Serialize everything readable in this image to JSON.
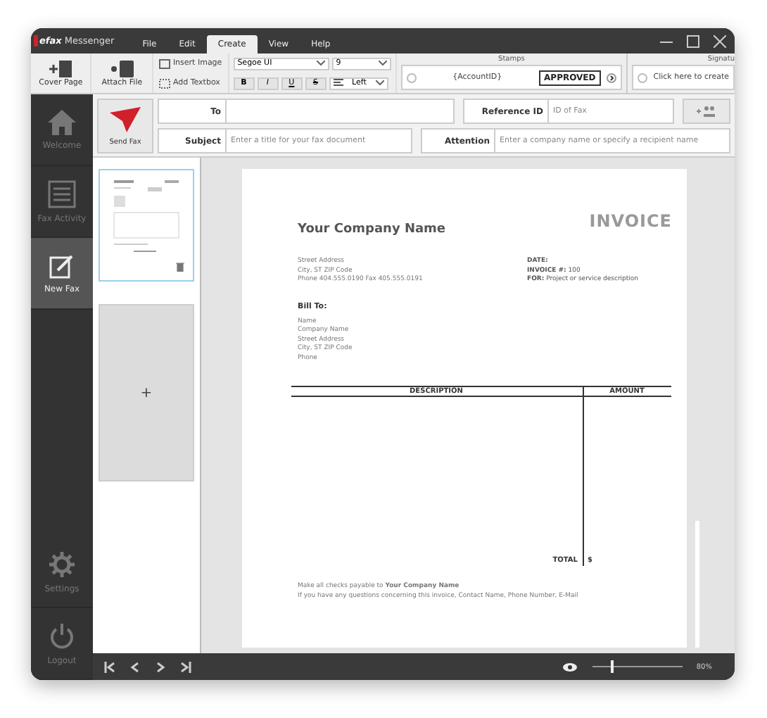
{
  "app": {
    "brand": "efax",
    "name": "Messenger"
  },
  "menu": [
    {
      "label": "File",
      "selected": false
    },
    {
      "label": "Edit",
      "selected": false
    },
    {
      "label": "Create",
      "selected": true
    },
    {
      "label": "View",
      "selected": false
    },
    {
      "label": "Help",
      "selected": false
    }
  ],
  "ribbon": {
    "big_buttons": [
      {
        "label": "Cover Page",
        "kind": "cover"
      },
      {
        "label": "Attach File",
        "kind": "attach"
      }
    ],
    "small_buttons": [
      {
        "label": "Insert Image",
        "kind": "image"
      },
      {
        "label": "Add Textbox",
        "kind": "textbox"
      }
    ],
    "font": "Segoe UI",
    "size": "9",
    "format_buttons": [
      "B",
      "I",
      "U",
      "S"
    ],
    "align": "Left",
    "stamps": {
      "title": "Stamps",
      "items": [
        "{AccountID}",
        "APPROVED"
      ]
    },
    "signatures": {
      "title": "Signatu",
      "item": "Click here to create"
    }
  },
  "send_fax": "Send Fax",
  "fields": {
    "to": {
      "label": "To"
    },
    "reference": {
      "label": "Reference ID",
      "placeholder": "ID of Fax"
    },
    "subject": {
      "label": "Subject",
      "placeholder": "Enter a title for your fax document"
    },
    "attention": {
      "label": "Attention",
      "placeholder": "Enter a company name or specify a recipient name"
    }
  },
  "sidebar": [
    {
      "label": "Welcome",
      "kind": "home",
      "selected": false
    },
    {
      "label": "Fax Activity",
      "kind": "activity",
      "selected": false
    },
    {
      "label": "New Fax",
      "kind": "newfax",
      "selected": true
    }
  ],
  "sidebar_bottom": [
    {
      "label": "Settings",
      "kind": "settings"
    },
    {
      "label": "Logout",
      "kind": "logout"
    }
  ],
  "pages": {
    "add_label": "+"
  },
  "invoice": {
    "company": "Your Company Name",
    "title": "INVOICE",
    "address": [
      "Street Address",
      "City, ST  ZIP Code",
      "Phone 404.555.0190   Fax 405.555.0191"
    ],
    "meta": [
      "**DATE:**",
      "**INVOICE #:**  100",
      "**FOR:** Project or service description"
    ],
    "bill_to": "Bill To:",
    "bill_lines": [
      "Name",
      "Company Name",
      "Street Address",
      "City, ST  ZIP Code",
      "Phone"
    ],
    "columns": [
      "DESCRIPTION",
      "AMOUNT"
    ],
    "total_label": "TOTAL",
    "total_value": "$",
    "footer": [
      "Make all checks payable to **Your Company Name**",
      "If you have any questions concerning this invoice, Contact Name, Phone Number, E-Mail"
    ]
  },
  "zoom": {
    "level": 0.2,
    "reading": "80%"
  }
}
